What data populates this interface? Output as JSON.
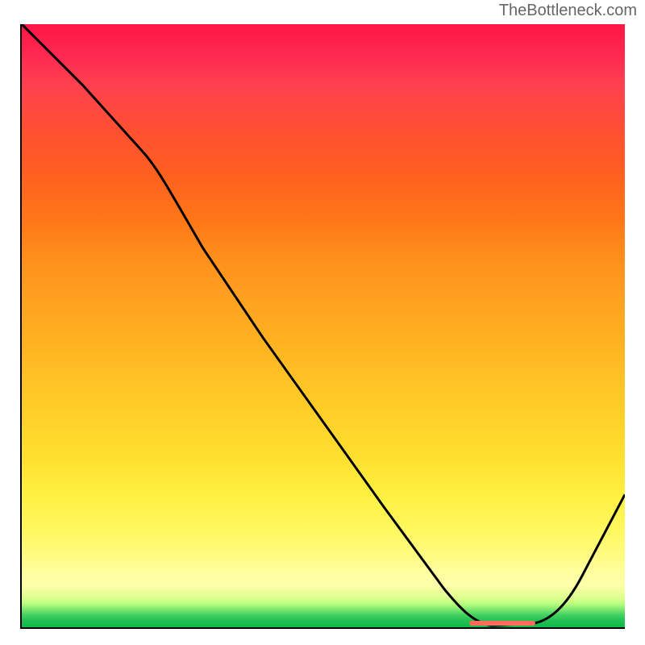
{
  "watermark": "TheBottleneck.com",
  "chart_data": {
    "type": "line",
    "title": "",
    "xlabel": "",
    "ylabel": "",
    "xlim": [
      0,
      100
    ],
    "ylim": [
      0,
      100
    ],
    "x": [
      0,
      10,
      20,
      30,
      40,
      50,
      60,
      70,
      78,
      85,
      100
    ],
    "values": [
      100,
      90,
      79,
      63,
      48,
      34,
      20,
      6,
      0,
      0.5,
      22
    ],
    "marker": {
      "x_start": 74,
      "x_end": 85,
      "y": 0.5,
      "color": "#ff6b5b"
    },
    "gradient_colors": {
      "top": "#ff1744",
      "middle": "#ffd028",
      "bottom": "#10b848"
    }
  }
}
